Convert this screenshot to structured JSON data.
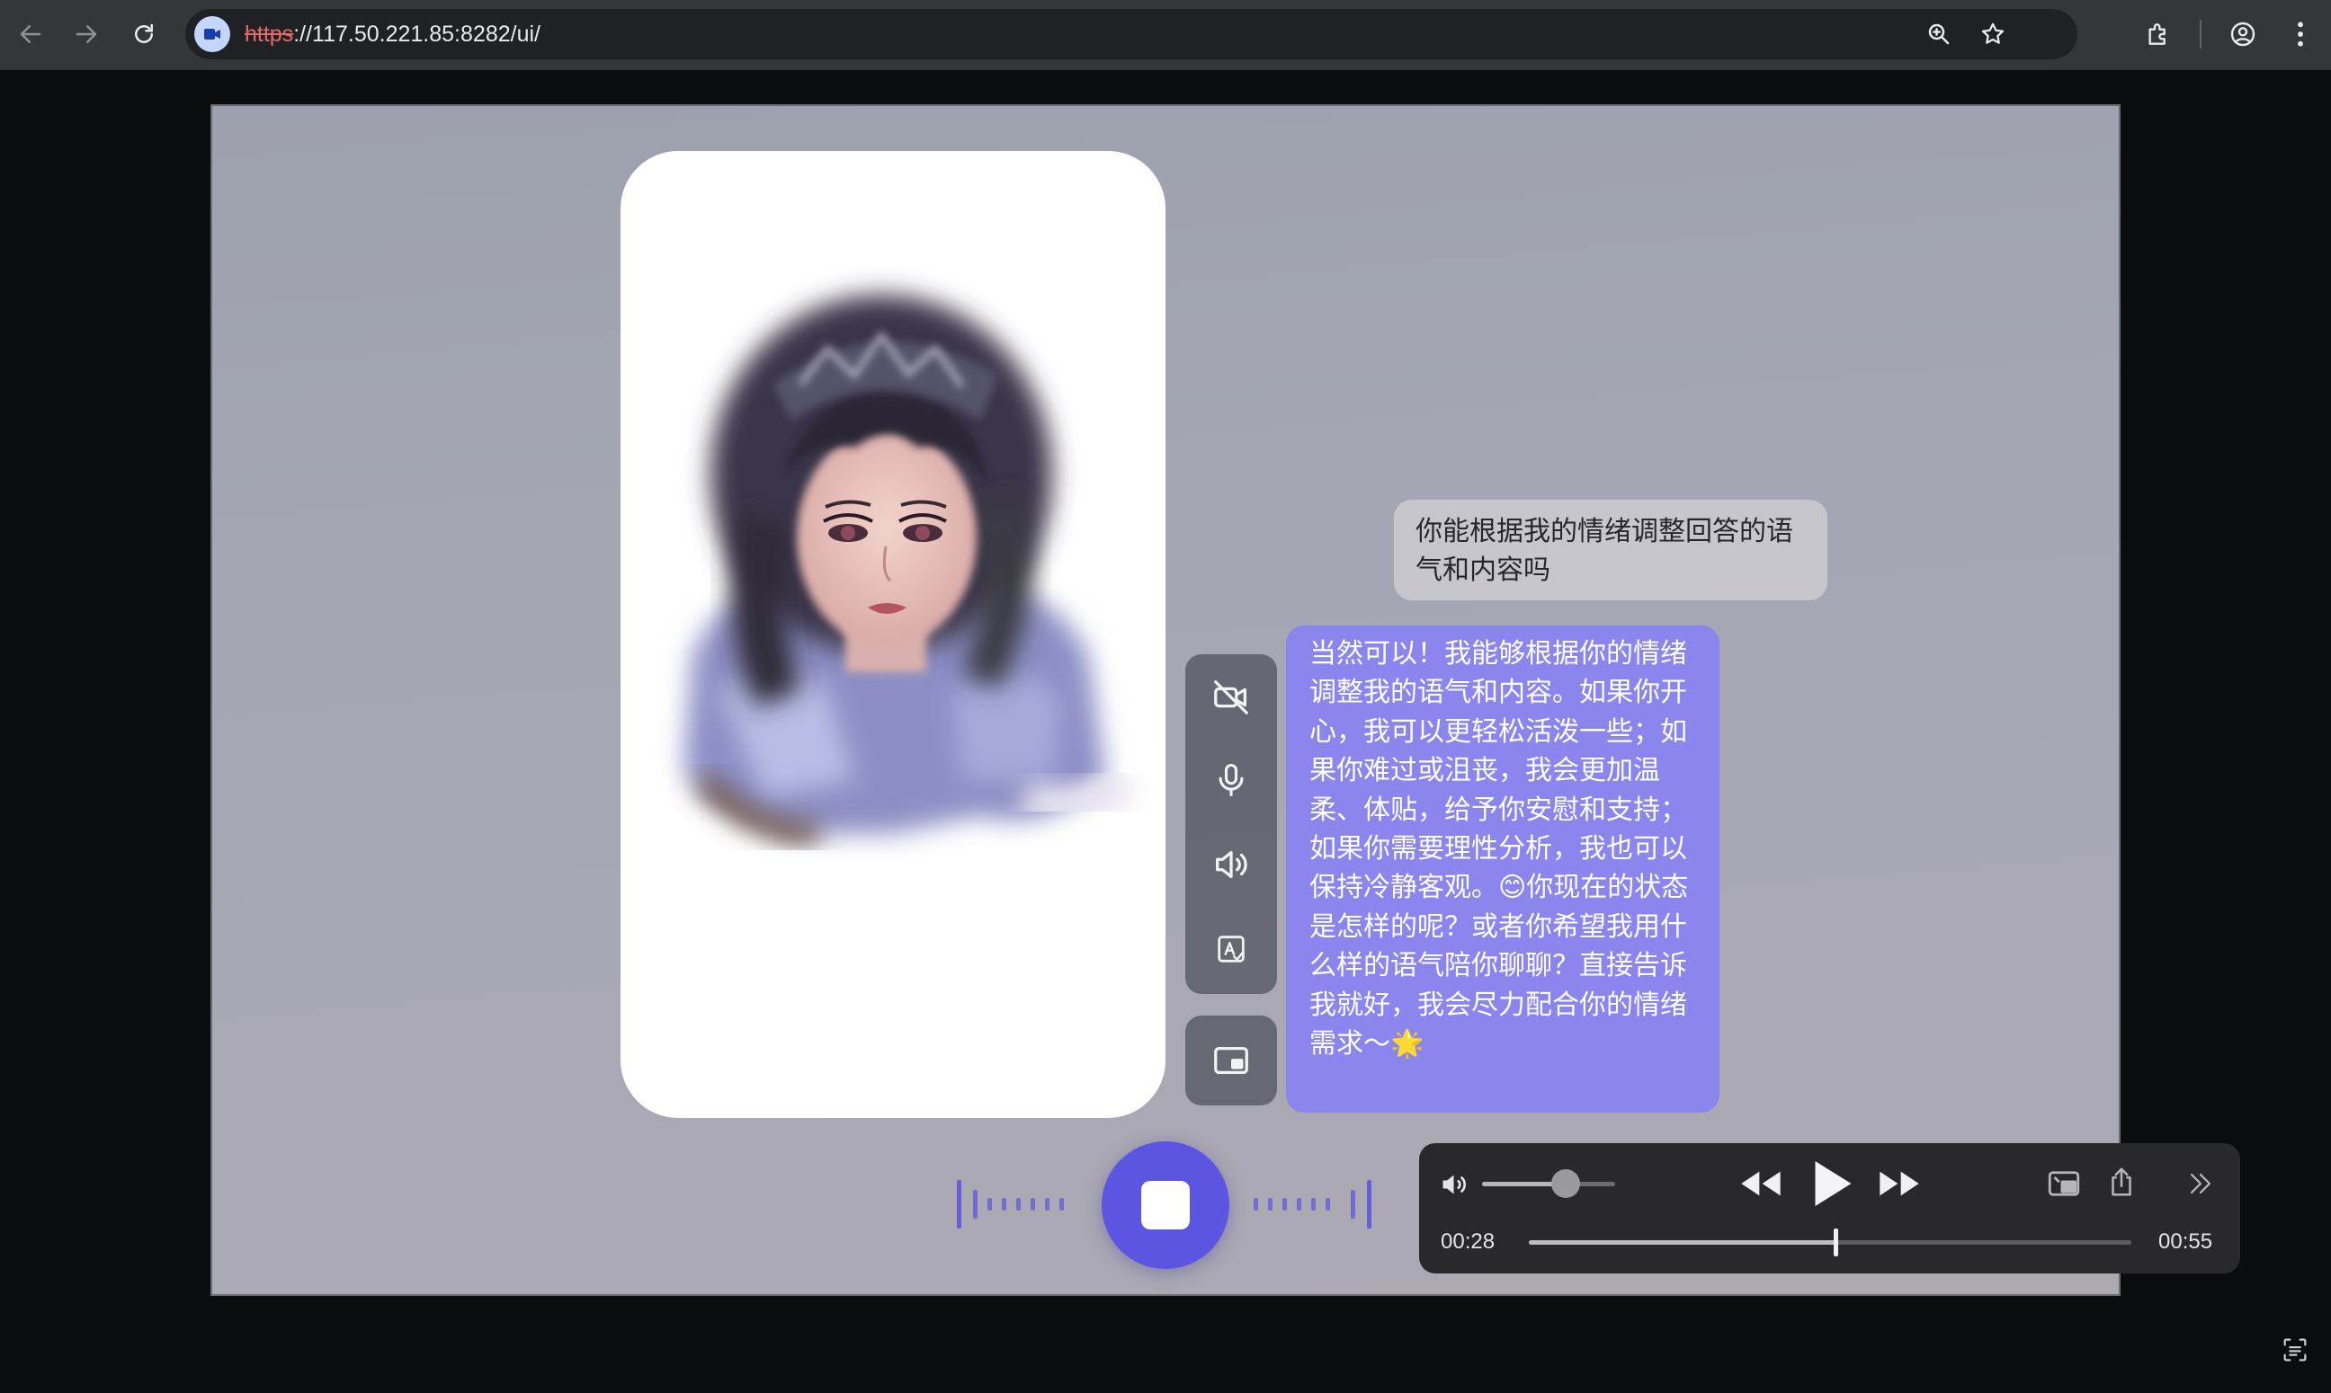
{
  "browser": {
    "url_scheme": "https",
    "url_rest": "://117.50.221.85:8282/ui/",
    "icons": {
      "back": "arrow-left-icon",
      "forward": "arrow-right-icon",
      "reload": "reload-icon",
      "site": "camera-icon",
      "zoom": "zoom-icon",
      "bookmark": "star-icon",
      "extensions": "puzzle-icon",
      "profile": "account-icon",
      "menu": "kebab-menu-icon"
    }
  },
  "chat": {
    "user_message": "你能根据我的情绪调整回答的语气和内容吗",
    "ai_message": "当然可以！我能够根据你的情绪调整我的语气和内容。如果你开心，我可以更轻松活泼一些；如果你难过或沮丧，我会更加温柔、体贴，给予你安慰和支持；如果你需要理性分析，我也可以保持冷静客观。😊你现在的状态是怎样的呢？或者你希望我用什么样的语气陪你聊聊？直接告诉我就好，我会尽力配合你的情绪需求～🌟"
  },
  "tools": [
    "camera-off-icon",
    "microphone-icon",
    "speaker-icon",
    "text-edit-icon",
    "picture-in-picture-icon"
  ],
  "media_player": {
    "current_time": "00:28",
    "duration": "00:55",
    "progress": 0.509,
    "volume": 0.63
  },
  "colors": {
    "accent": "#5b55e2",
    "ai_bubble": "#8b86ee",
    "user_bubble": "#c6c6cc",
    "content_background": "#a3a5b2",
    "toolbar": "#35363a"
  }
}
